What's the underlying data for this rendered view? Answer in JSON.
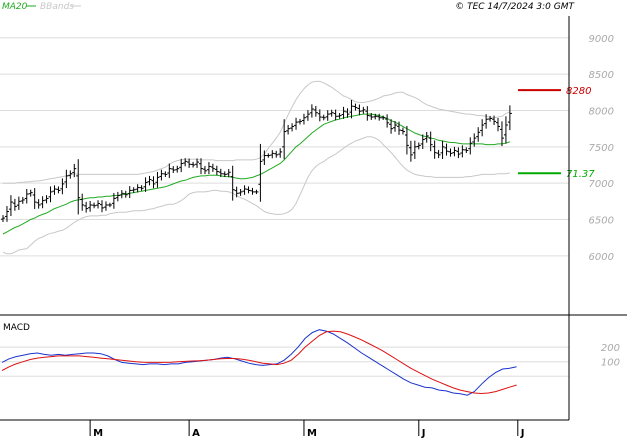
{
  "header": {
    "legend_ma": "MA20",
    "legend_bb": "BBands",
    "copyright": "© TEC 14/7/2024 3:0 GMT"
  },
  "colors": {
    "ma": "#22aa22",
    "bbands": "#c8c8c8",
    "price": "#000000",
    "resistance": "#cc0000",
    "support": "#00aa00",
    "macd": "#1a33cc",
    "signal": "#dd1111",
    "grid": "#dddddd",
    "axis_text": "#aaaaaa"
  },
  "chart_data": [
    {
      "type": "ohlc",
      "title": "",
      "ylim": [
        5200,
        9300
      ],
      "y_ticks": [
        6000,
        6500,
        7000,
        7500,
        8000,
        8500,
        9000
      ],
      "y_tick_labels": [
        "6000",
        "6500",
        "7000",
        "7500",
        "8000",
        "8500",
        "9000"
      ],
      "x_month_labels": [
        {
          "label": "M",
          "bar": 22
        },
        {
          "label": "A",
          "bar": 47
        },
        {
          "label": "M",
          "bar": 76
        },
        {
          "label": "J",
          "bar": 105
        },
        {
          "label": "J",
          "bar": 130
        }
      ],
      "levels": [
        {
          "name": "resistance",
          "value": 8280,
          "label": "8280"
        },
        {
          "name": "support",
          "value": 7137,
          "label": "71.37"
        }
      ],
      "close": [
        6520,
        6610,
        6740,
        6680,
        6750,
        6770,
        6850,
        6870,
        6740,
        6700,
        6760,
        6790,
        6880,
        6920,
        6900,
        6990,
        7100,
        7130,
        7200,
        6800,
        6700,
        6650,
        6700,
        6690,
        6720,
        6660,
        6700,
        6700,
        6790,
        6830,
        6860,
        6840,
        6900,
        6910,
        6940,
        6930,
        7010,
        7050,
        6990,
        7080,
        7130,
        7120,
        7200,
        7180,
        7200,
        7270,
        7300,
        7260,
        7250,
        7290,
        7200,
        7170,
        7230,
        7200,
        7160,
        7130,
        7120,
        7150,
        6910,
        6860,
        6880,
        6920,
        6900,
        6880,
        6880,
        7300,
        7380,
        7380,
        7410,
        7390,
        7430,
        7710,
        7750,
        7780,
        7840,
        7850,
        7900,
        7950,
        8020,
        7970,
        7910,
        7900,
        7950,
        7970,
        7920,
        7930,
        7990,
        7950,
        8060,
        8040,
        7990,
        8010,
        7930,
        7910,
        7920,
        7900,
        7900,
        7830,
        7750,
        7800,
        7730,
        7710,
        7520,
        7390,
        7500,
        7520,
        7600,
        7650,
        7530,
        7420,
        7390,
        7500,
        7440,
        7410,
        7450,
        7400,
        7460,
        7450,
        7550,
        7620,
        7700,
        7800,
        7880,
        7890,
        7850,
        7780,
        7620,
        7800,
        7960
      ],
      "ma20": [
        6300,
        6330,
        6360,
        6390,
        6410,
        6440,
        6470,
        6500,
        6520,
        6550,
        6570,
        6590,
        6620,
        6650,
        6670,
        6690,
        6710,
        6740,
        6760,
        6770,
        6780,
        6790,
        6800,
        6800,
        6810,
        6810,
        6820,
        6820,
        6830,
        6830,
        6840,
        6850,
        6860,
        6870,
        6880,
        6890,
        6900,
        6910,
        6920,
        6930,
        6940,
        6950,
        6970,
        6990,
        7010,
        7030,
        7040,
        7060,
        7080,
        7090,
        7100,
        7100,
        7110,
        7110,
        7110,
        7100,
        7090,
        7090,
        7080,
        7070,
        7060,
        7060,
        7070,
        7080,
        7100,
        7120,
        7150,
        7180,
        7210,
        7240,
        7270,
        7320,
        7380,
        7440,
        7500,
        7540,
        7590,
        7640,
        7690,
        7730,
        7770,
        7810,
        7830,
        7850,
        7870,
        7880,
        7900,
        7910,
        7920,
        7930,
        7940,
        7950,
        7950,
        7950,
        7940,
        7930,
        7910,
        7890,
        7860,
        7840,
        7810,
        7780,
        7750,
        7720,
        7690,
        7670,
        7650,
        7640,
        7620,
        7610,
        7590,
        7580,
        7570,
        7560,
        7560,
        7550,
        7540,
        7540,
        7540,
        7540,
        7540,
        7540,
        7530,
        7530,
        7530,
        7540,
        7540,
        7550,
        7570
      ],
      "bb_upper": [
        7000,
        7000,
        7000,
        7000,
        7010,
        7010,
        7020,
        7020,
        7030,
        7030,
        7040,
        7050,
        7060,
        7070,
        7080,
        7090,
        7100,
        7110,
        7130,
        7120,
        7120,
        7120,
        7120,
        7120,
        7120,
        7120,
        7120,
        7120,
        7120,
        7120,
        7120,
        7120,
        7120,
        7120,
        7120,
        7130,
        7140,
        7150,
        7160,
        7180,
        7200,
        7220,
        7260,
        7290,
        7310,
        7320,
        7330,
        7330,
        7330,
        7330,
        7320,
        7320,
        7320,
        7320,
        7310,
        7310,
        7310,
        7310,
        7310,
        7320,
        7320,
        7320,
        7320,
        7320,
        7330,
        7350,
        7400,
        7480,
        7550,
        7620,
        7700,
        7820,
        7940,
        8050,
        8150,
        8230,
        8300,
        8350,
        8390,
        8400,
        8400,
        8380,
        8350,
        8320,
        8280,
        8240,
        8200,
        8180,
        8150,
        8120,
        8110,
        8110,
        8120,
        8130,
        8150,
        8170,
        8200,
        8210,
        8220,
        8240,
        8250,
        8250,
        8220,
        8200,
        8180,
        8150,
        8110,
        8080,
        8060,
        8040,
        8020,
        8010,
        8000,
        7990,
        7980,
        7970,
        7960,
        7950,
        7950,
        7940,
        7930,
        7930,
        7920,
        7910,
        7900,
        7910,
        7920,
        7960,
        7980
      ],
      "bb_lower": [
        6050,
        6030,
        6030,
        6050,
        6080,
        6090,
        6100,
        6150,
        6200,
        6240,
        6260,
        6290,
        6310,
        6320,
        6340,
        6350,
        6380,
        6420,
        6460,
        6490,
        6520,
        6540,
        6550,
        6550,
        6550,
        6560,
        6560,
        6580,
        6590,
        6600,
        6600,
        6600,
        6610,
        6620,
        6620,
        6620,
        6630,
        6640,
        6650,
        6670,
        6680,
        6700,
        6710,
        6710,
        6730,
        6760,
        6800,
        6850,
        6870,
        6880,
        6880,
        6880,
        6890,
        6900,
        6900,
        6890,
        6890,
        6880,
        6860,
        6830,
        6800,
        6780,
        6750,
        6720,
        6690,
        6650,
        6610,
        6590,
        6580,
        6570,
        6570,
        6580,
        6600,
        6640,
        6720,
        6840,
        6960,
        7080,
        7170,
        7230,
        7270,
        7300,
        7340,
        7370,
        7400,
        7440,
        7480,
        7520,
        7550,
        7580,
        7600,
        7620,
        7640,
        7640,
        7620,
        7590,
        7530,
        7480,
        7420,
        7360,
        7290,
        7230,
        7180,
        7150,
        7120,
        7110,
        7100,
        7090,
        7090,
        7080,
        7080,
        7080,
        7080,
        7080,
        7080,
        7080,
        7080,
        7090,
        7090,
        7100,
        7110,
        7120,
        7120,
        7120,
        7120,
        7130,
        7130,
        7130,
        7140
      ]
    },
    {
      "type": "line",
      "title": "MACD",
      "ylim": [
        -300,
        400
      ],
      "y_ticks": [
        100,
        200
      ],
      "y_tick_labels": [
        "100",
        "200"
      ],
      "series": [
        {
          "name": "MACD",
          "values": [
            95,
            120,
            135,
            145,
            155,
            160,
            150,
            145,
            150,
            145,
            150,
            155,
            160,
            160,
            155,
            140,
            115,
            95,
            90,
            85,
            80,
            85,
            85,
            80,
            85,
            85,
            95,
            100,
            105,
            110,
            115,
            125,
            130,
            120,
            105,
            90,
            80,
            75,
            80,
            85,
            110,
            150,
            200,
            260,
            300,
            320,
            310,
            290,
            260,
            230,
            195,
            160,
            130,
            100,
            70,
            40,
            10,
            -20,
            -45,
            -60,
            -75,
            -80,
            -95,
            -100,
            -115,
            -120,
            -130,
            -105,
            -55,
            -10,
            25,
            50,
            55,
            65
          ]
        },
        {
          "name": "Signal",
          "values": [
            40,
            65,
            85,
            100,
            115,
            125,
            130,
            135,
            140,
            140,
            140,
            140,
            135,
            130,
            125,
            120,
            115,
            110,
            105,
            100,
            97,
            95,
            95,
            95,
            97,
            100,
            102,
            105,
            107,
            110,
            115,
            120,
            122,
            122,
            118,
            110,
            100,
            90,
            85,
            80,
            90,
            110,
            150,
            200,
            240,
            280,
            305,
            310,
            305,
            290,
            270,
            250,
            225,
            200,
            175,
            145,
            115,
            85,
            55,
            30,
            5,
            -20,
            -40,
            -60,
            -80,
            -95,
            -105,
            -115,
            -118,
            -115,
            -105,
            -90,
            -75,
            -60
          ]
        }
      ]
    }
  ]
}
